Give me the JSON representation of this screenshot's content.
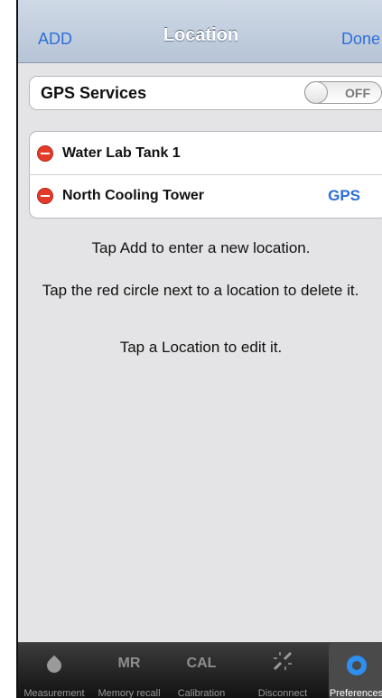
{
  "navbar": {
    "left_label": "ADD",
    "title": "Location",
    "right_label": "Done"
  },
  "gps": {
    "label": "GPS Services",
    "toggle_text": "OFF"
  },
  "locations": [
    {
      "name": "Water Lab Tank 1",
      "tag": ""
    },
    {
      "name": "North Cooling Tower",
      "tag": "GPS"
    }
  ],
  "instructions": {
    "add": "Tap Add to enter a new location.",
    "delete": "Tap the red circle next to a location to delete it.",
    "edit": "Tap a Location to edit it."
  },
  "tabbar": {
    "items": [
      {
        "label": "Measurement",
        "icon": "drop-icon"
      },
      {
        "label": "Memory recall",
        "icon_text": "MR"
      },
      {
        "label": "Calibration",
        "icon_text": "CAL"
      },
      {
        "label": "Disconnect",
        "icon": "disconnect-icon"
      },
      {
        "label": "Preferences",
        "icon": "gear-icon"
      }
    ]
  },
  "colors": {
    "accent": "#2e6fd8",
    "delete": "#e43a2a",
    "tabbar": "#1e1e1e"
  }
}
